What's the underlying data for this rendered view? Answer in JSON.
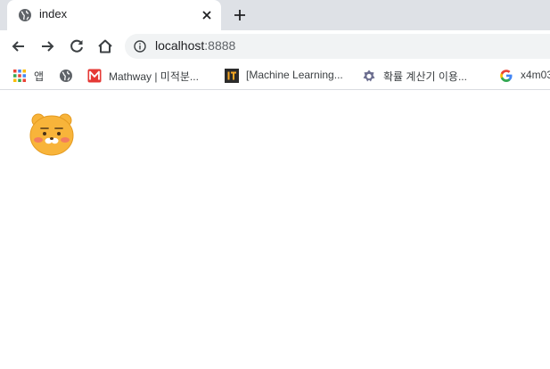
{
  "tab": {
    "title": "index",
    "favicon": "globe-icon",
    "close_icon": "close-icon"
  },
  "new_tab_icon": "plus-icon",
  "toolbar": {
    "back_icon": "arrow-left-icon",
    "forward_icon": "arrow-right-icon",
    "reload_icon": "reload-icon",
    "home_icon": "home-icon",
    "info_icon": "info-icon",
    "url_host": "localhost",
    "url_port": ":8888"
  },
  "bookmarks": [
    {
      "label": "앱",
      "icon": "apps-grid-icon"
    },
    {
      "label": "",
      "icon": "globe-icon"
    },
    {
      "label": "Mathway | 미적분...",
      "icon": "mathway-icon"
    },
    {
      "label": "[Machine Learning...",
      "icon": "it-logo-icon"
    },
    {
      "label": "확률 계산기 이용...",
      "icon": "gear-flower-icon"
    },
    {
      "label": "x4m03",
      "icon": "google-g-icon"
    }
  ],
  "page": {
    "image": "ryan-character-face"
  },
  "colors": {
    "tab_strip": "#dee1e6",
    "omnibox": "#f1f3f4",
    "character_fill": "#f8b43a"
  }
}
